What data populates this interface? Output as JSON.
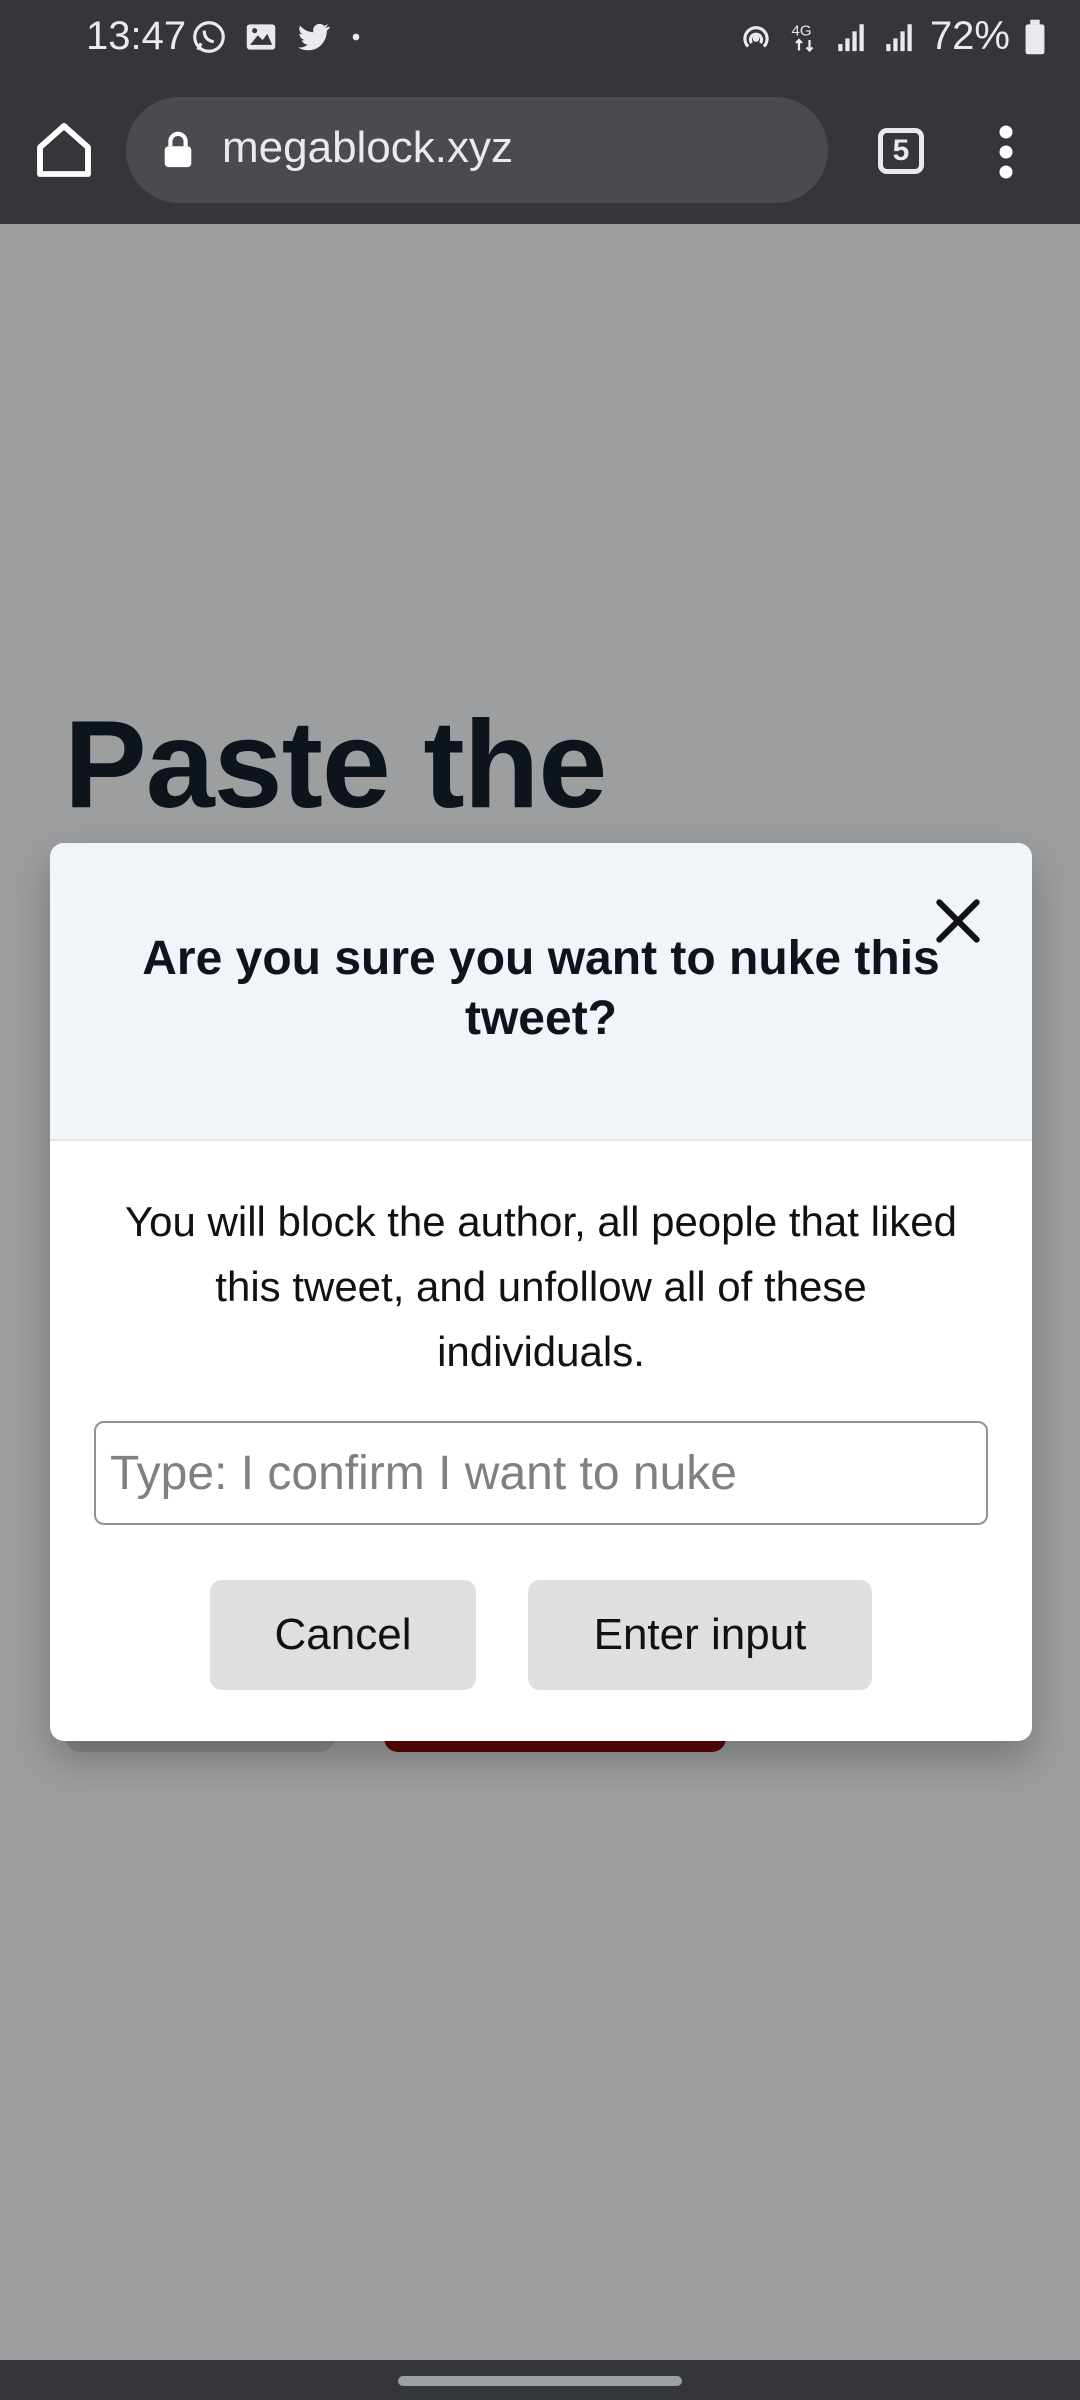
{
  "status_bar": {
    "time": "13:47",
    "network": "4G",
    "battery": "72%",
    "notification_icons": [
      "whatsapp-icon",
      "gallery-icon",
      "twitter-icon",
      "dot-icon"
    ]
  },
  "browser": {
    "url": "megablock.xyz",
    "tab_count": "5"
  },
  "page": {
    "heading": "Paste the"
  },
  "modal": {
    "title": "Are you sure you want to nuke this tweet?",
    "body": "You will block the author, all people that liked this tweet, and unfollow all of these individuals.",
    "input_placeholder": "Type: I confirm I want to nuke",
    "input_value": "",
    "cancel_label": "Cancel",
    "enter_label": "Enter input"
  },
  "colors": {
    "overlay": "#9c9e9f",
    "chrome": "#35363a",
    "modal_header": "#f1f5f9",
    "danger": "#5c0505"
  }
}
